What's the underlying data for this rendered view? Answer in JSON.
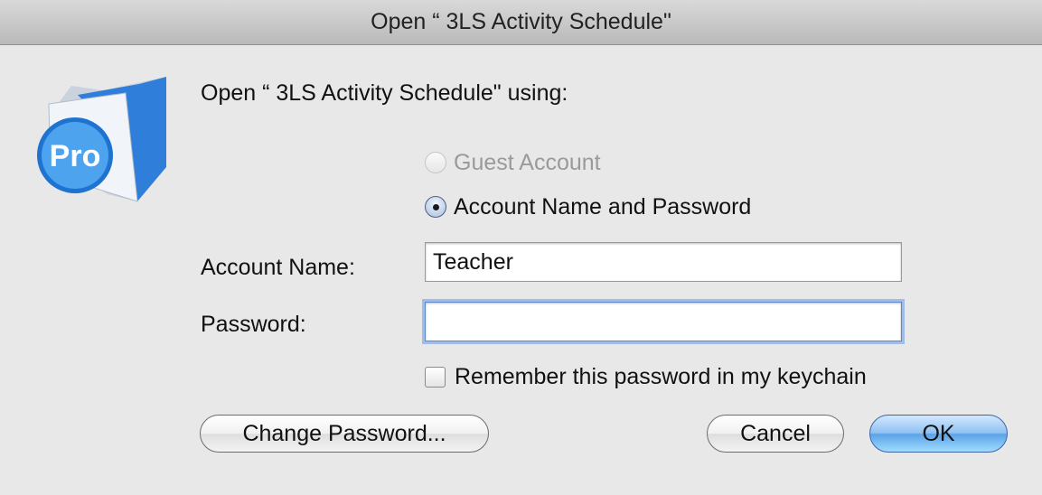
{
  "window": {
    "title": "Open “ 3LS Activity Schedule\""
  },
  "prompt": "Open “ 3LS Activity Schedule\" using:",
  "app_icon": {
    "name": "filemaker-pro-icon",
    "badge": "Pro"
  },
  "options": {
    "guest": {
      "label": "Guest Account",
      "enabled": false,
      "selected": false
    },
    "named": {
      "label": "Account Name and Password",
      "enabled": true,
      "selected": true
    }
  },
  "fields": {
    "account_name": {
      "label": "Account Name:",
      "value": "Teacher"
    },
    "password": {
      "label": "Password:",
      "value": ""
    }
  },
  "keychain": {
    "label": "Remember this password in my keychain",
    "checked": false
  },
  "buttons": {
    "change_password": "Change Password...",
    "cancel": "Cancel",
    "ok": "OK"
  }
}
